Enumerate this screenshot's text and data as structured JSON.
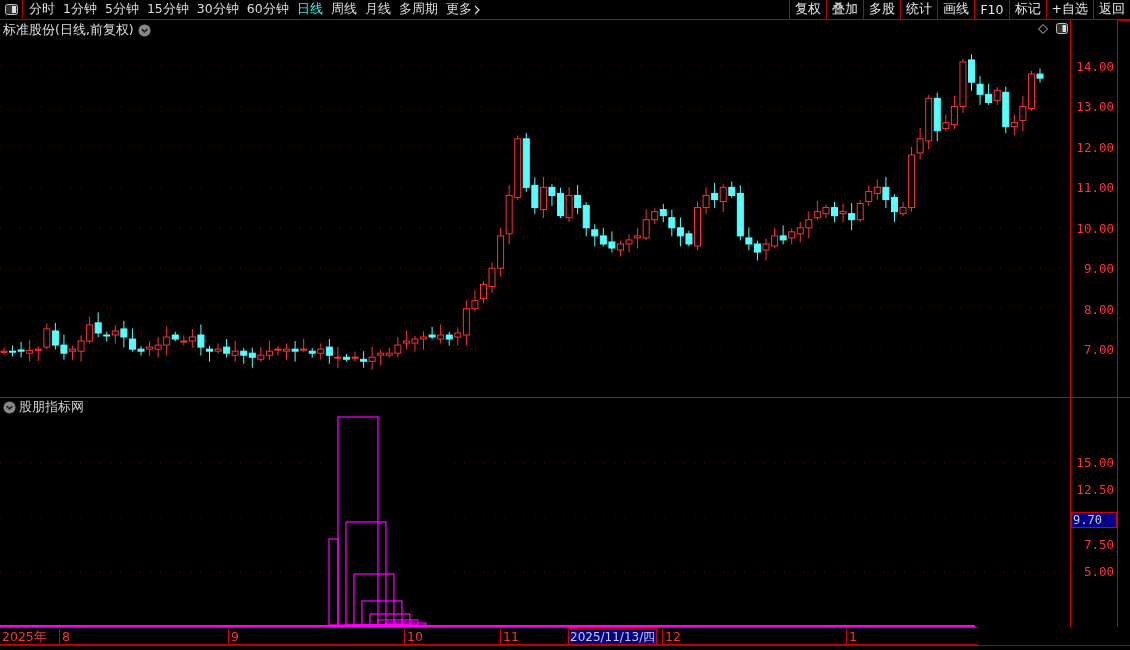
{
  "toolbar": {
    "periods": [
      {
        "label": "分时",
        "selected": false,
        "kind": "period"
      },
      {
        "label": "1分钟",
        "selected": false,
        "kind": "period"
      },
      {
        "label": "5分钟",
        "selected": false,
        "kind": "period"
      },
      {
        "label": "15分钟",
        "selected": false,
        "kind": "period"
      },
      {
        "label": "30分钟",
        "selected": false,
        "kind": "period"
      },
      {
        "label": "60分钟",
        "selected": false,
        "kind": "period"
      },
      {
        "label": "日线",
        "selected": true,
        "kind": "period"
      },
      {
        "label": "周线",
        "selected": false,
        "kind": "period"
      },
      {
        "label": "月线",
        "selected": false,
        "kind": "period"
      },
      {
        "label": "多周期",
        "selected": false,
        "kind": "period"
      },
      {
        "label": "更多",
        "selected": false,
        "kind": "menu"
      }
    ],
    "actions": [
      "复权",
      "叠加",
      "多股",
      "统计",
      "画线",
      "F10",
      "标记",
      "+自选",
      "返回"
    ]
  },
  "price_pane": {
    "title": "标准股份(日线,前复权)",
    "y_ticks": [
      "14.00",
      "13.00",
      "12.00",
      "11.00",
      "10.00",
      "9.00",
      "8.00",
      "7.00"
    ]
  },
  "indicator_pane": {
    "title": "股朋指标网",
    "y_ticks": [
      "15.00",
      "12.50",
      "7.50",
      "5.00"
    ],
    "marker": "9.70"
  },
  "date_axis": {
    "labels": [
      "2025年",
      "8",
      "9",
      "10",
      "11",
      "12",
      "1"
    ],
    "cursor_date": "2025/11/13/四"
  }
}
